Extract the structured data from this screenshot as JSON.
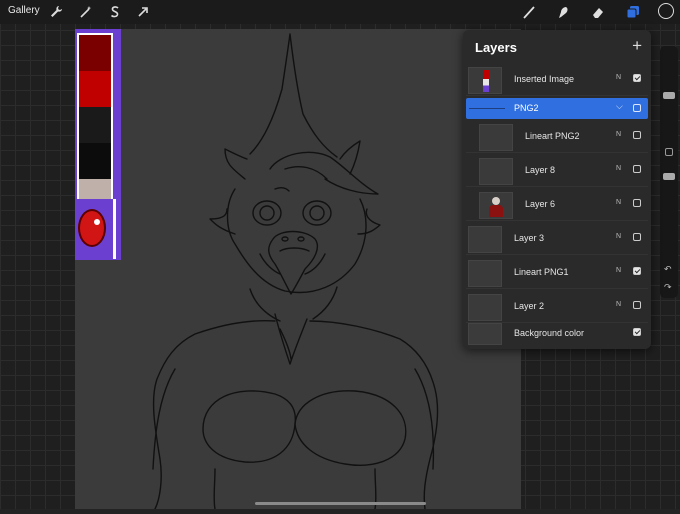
{
  "app": {
    "gallery_label": "Gallery"
  },
  "toolbar": {
    "left_icons": [
      "wrench-icon",
      "magic-wand-icon",
      "selection-s-icon",
      "arrow-transform-icon"
    ],
    "right_icons": [
      "brush-icon",
      "smudge-icon",
      "eraser-icon",
      "layers-icon",
      "color-swatch"
    ],
    "active_color": "#1b1b1b",
    "accent": "#2f6fe0"
  },
  "layers_panel": {
    "title": "Layers",
    "add_icon": "+",
    "layers": [
      {
        "name": "Inserted Image",
        "blend": "N",
        "visible": true,
        "active": false,
        "indent": false
      },
      {
        "name": "PNG2",
        "blend": "",
        "visible": false,
        "active": true,
        "indent": false,
        "group": true
      },
      {
        "name": "Lineart PNG2",
        "blend": "N",
        "visible": false,
        "active": false,
        "indent": true
      },
      {
        "name": "Layer 8",
        "blend": "N",
        "visible": false,
        "active": false,
        "indent": true
      },
      {
        "name": "Layer 6",
        "blend": "N",
        "visible": false,
        "active": false,
        "indent": true
      },
      {
        "name": "Layer 3",
        "blend": "N",
        "visible": false,
        "active": false,
        "indent": false
      },
      {
        "name": "Lineart PNG1",
        "blend": "N",
        "visible": true,
        "active": false,
        "indent": false
      },
      {
        "name": "Layer 2",
        "blend": "N",
        "visible": false,
        "active": false,
        "indent": false
      },
      {
        "name": "Background color",
        "blend": "",
        "visible": true,
        "active": false,
        "indent": false
      }
    ]
  },
  "reference_palette": [
    "#7a0000",
    "#c00000",
    "#1a1a1a",
    "#0c0c0c",
    "#bfb0aa",
    "#e6e6e6"
  ]
}
